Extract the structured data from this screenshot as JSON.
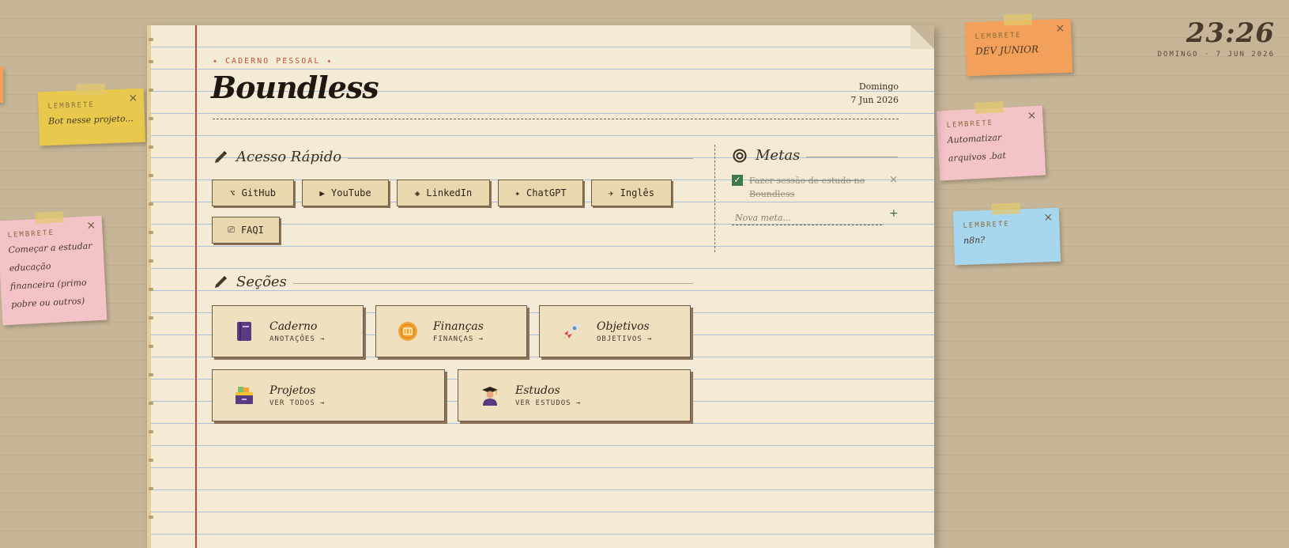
{
  "clock": {
    "time": "23:26",
    "date": "DOMINGO · 7 JUN 2026"
  },
  "notebook": {
    "eyebrow": "✦ CADERNO PESSOAL ✦",
    "title": "Boundless",
    "day": "Domingo",
    "date": "7 Jun 2026"
  },
  "quick_access": {
    "heading": "Acesso Rápido",
    "buttons": [
      {
        "glyph": "⌥",
        "label": "GitHub"
      },
      {
        "glyph": "▶",
        "label": "YouTube"
      },
      {
        "glyph": "◈",
        "label": "LinkedIn"
      },
      {
        "glyph": "✦",
        "label": "ChatGPT"
      },
      {
        "glyph": "✈",
        "label": "Inglês"
      },
      {
        "glyph": "⎚",
        "label": "FAQI"
      }
    ]
  },
  "sections": {
    "heading": "Seções",
    "cards": [
      {
        "title": "Caderno",
        "sub": "ANOTAÇÕES →",
        "icon": "book-icon"
      },
      {
        "title": "Finanças",
        "sub": "FINANÇAS →",
        "icon": "coin-icon"
      },
      {
        "title": "Objetivos",
        "sub": "OBJETIVOS →",
        "icon": "rocket-icon"
      },
      {
        "title": "Projetos",
        "sub": "VER TODOS →",
        "icon": "card-box-icon"
      },
      {
        "title": "Estudos",
        "sub": "VER ESTUDOS →",
        "icon": "graduate-icon"
      }
    ]
  },
  "goals": {
    "heading": "Metas",
    "items": [
      {
        "text": "Fazer sessão de estudo no Boundless",
        "done": true
      }
    ],
    "placeholder": "Nova meta...",
    "add": "+",
    "remove": "×"
  },
  "notes": [
    {
      "label": "LEMBRETE",
      "text": "DEV JUNIOR",
      "color": "#f2a05a"
    },
    {
      "label": "LEMBRETE",
      "text": "Bot nesse projeto...",
      "color": "#e8c94e"
    },
    {
      "label": "LEMBRETE",
      "text": "Automatizar arquivos .bat",
      "color": "#f4c3c8"
    },
    {
      "label": "LEMBRETE",
      "text": "n8n?",
      "color": "#a7d6ef"
    },
    {
      "label": "LEMBRETE",
      "text": "Começar a estudar educação financeira (primo pobre ou outros)",
      "color": "#f4c3c8"
    }
  ],
  "note_close": "×",
  "colors": {
    "paper": "#f4ebd6",
    "margin_line": "#c6443a",
    "desk": "#c6b596",
    "accent": "#c0503c"
  }
}
